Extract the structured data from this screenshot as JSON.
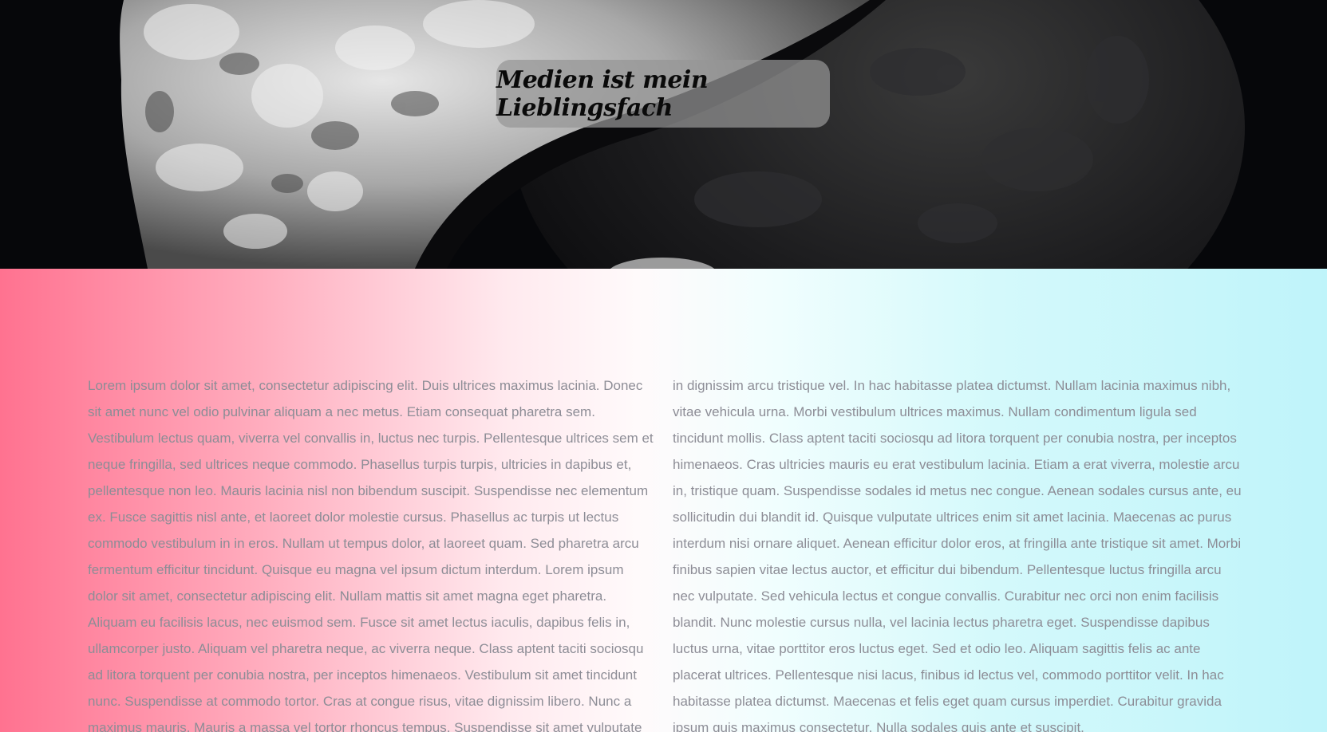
{
  "hero": {
    "title": "Medien ist mein Lieblingsfach",
    "background_color": "#06070a",
    "title_box_color": "#969696"
  },
  "content": {
    "gradient_colors": [
      "#ff7290",
      "#fffafb",
      "#bff4fa"
    ],
    "text_color": "#8d8d96",
    "columns": [
      "Lorem ipsum dolor sit amet, consectetur adipiscing elit. Duis ultrices maximus lacinia. Donec sit amet nunc vel odio pulvinar aliquam a nec metus. Etiam consequat pharetra sem. Vestibulum lectus quam, viverra vel convallis in, luctus nec turpis. Pellentesque ultrices sem et neque fringilla, sed ultrices neque commodo. Phasellus turpis turpis, ultricies in dapibus et, pellentesque non leo. Mauris lacinia nisl non bibendum suscipit. Suspendisse nec elementum ex. Fusce sagittis nisl ante, et laoreet dolor molestie cursus. Phasellus ac turpis ut lectus commodo vestibulum in in eros. Nullam ut tempus dolor, at laoreet quam. Sed pharetra arcu fermentum efficitur tincidunt. Quisque eu magna vel ipsum dictum interdum. Lorem ipsum dolor sit amet, consectetur adipiscing elit. Nullam mattis sit amet magna eget pharetra. Aliquam eu facilisis lacus, nec euismod sem. Fusce sit amet lectus iaculis, dapibus felis in, ullamcorper justo. Aliquam vel pharetra neque, ac viverra neque. Class aptent taciti sociosqu ad litora torquent per conubia nostra, per inceptos himenaeos. Vestibulum sit amet tincidunt nunc. Suspendisse at commodo tortor. Cras at congue risus, vitae dignissim libero. Nunc a maximus mauris. Mauris a massa vel tortor rhoncus tempus. Suspendisse sit amet vulputate tellus, a rhoncus sapien. Aenean egestas erat libero. Curabitur varius sem quam,",
      "in dignissim arcu tristique vel. In hac habitasse platea dictumst. Nullam lacinia maximus nibh, vitae vehicula urna. Morbi vestibulum ultrices maximus. Nullam condimentum ligula sed tincidunt mollis. Class aptent taciti sociosqu ad litora torquent per conubia nostra, per inceptos himenaeos. Cras ultricies mauris eu erat vestibulum lacinia. Etiam a erat viverra, molestie arcu in, tristique quam. Suspendisse sodales id metus nec congue. Aenean sodales cursus ante, eu sollicitudin dui blandit id. Quisque vulputate ultrices enim sit amet lacinia. Maecenas ac purus interdum nisi ornare aliquet. Aenean efficitur dolor eros, at fringilla ante tristique sit amet. Morbi finibus sapien vitae lectus auctor, et efficitur dui bibendum. Pellentesque luctus fringilla arcu nec vulputate. Sed vehicula lectus et congue convallis. Curabitur nec orci non enim facilisis blandit. Nunc molestie cursus nulla, vel lacinia lectus pharetra eget. Suspendisse dapibus luctus urna, vitae porttitor eros luctus eget. Sed et odio leo. Aliquam sagittis felis ac ante placerat ultrices. Pellentesque nisi lacus, finibus id lectus vel, commodo porttitor velit. In hac habitasse platea dictumst. Maecenas et felis eget quam cursus imperdiet. Curabitur gravida ipsum quis maximus consectetur. Nulla sodales quis ante et suscipit."
    ]
  }
}
